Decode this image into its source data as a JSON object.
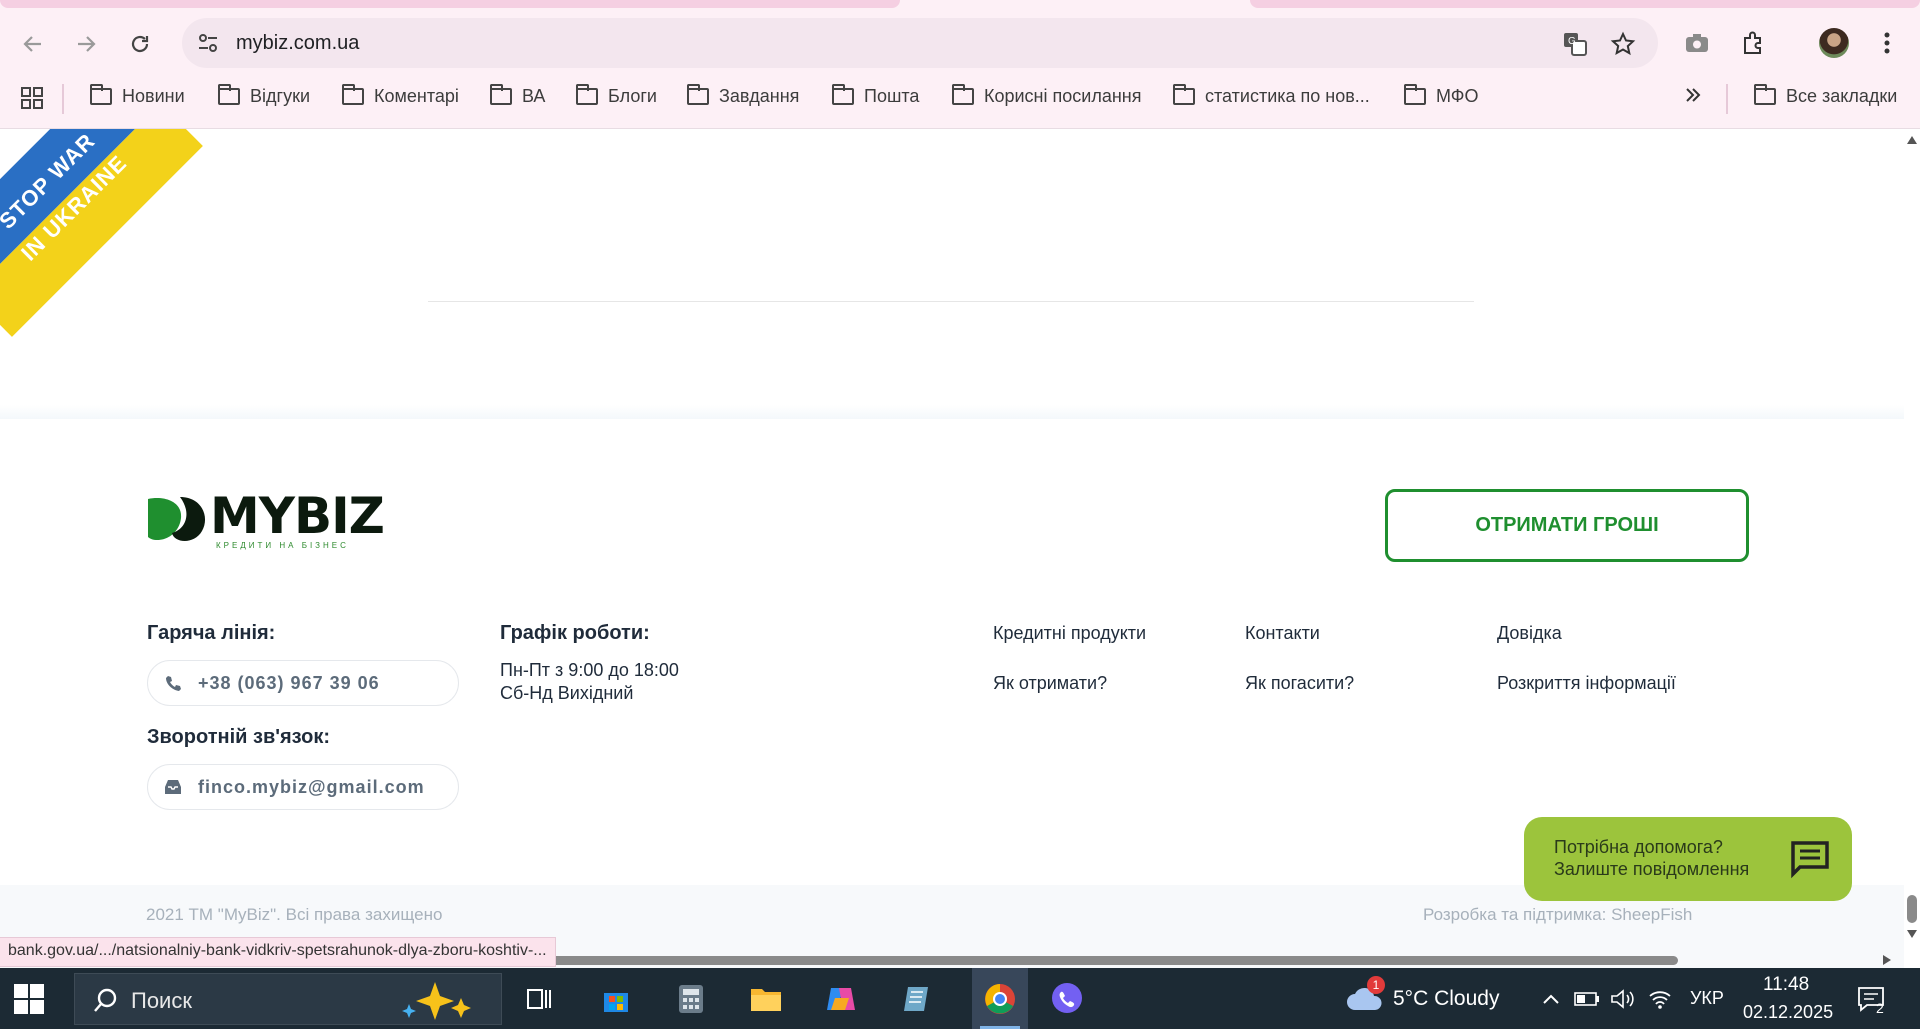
{
  "browser": {
    "url": "mybiz.com.ua",
    "bookmarks": [
      "Новини",
      "Відгуки",
      "Коментарі",
      "ВА",
      "Блоги",
      "Завдання",
      "Пошта",
      "Корисні посилання",
      "статистика по нов...",
      "МФО"
    ],
    "all_bookmarks": "Все закладки",
    "status_url": "bank.gov.ua/.../natsionalniy-bank-vidkriv-spetsrahunok-dlya-zboru-koshtiv-..."
  },
  "ribbon": {
    "line1": "STOP WAR",
    "line2": "IN UKRAINE"
  },
  "footer": {
    "logo_text": "MYBIZ",
    "logo_sub": "КРЕДИТИ НА БІЗНЕС",
    "cta_label": "ОТРИМАТИ ГРОШІ",
    "hotline_label": "Гаряча лінія:",
    "phone": "+38 (063) 967 39 06",
    "feedback_label": "Зворотній зв'язок:",
    "email": "finco.mybiz@gmail.com",
    "schedule_label": "Графік роботи:",
    "schedule_line1": "Пн-Пт з 9:00 до 18:00",
    "schedule_line2": "Сб-Нд Вихідний",
    "links": {
      "credit_products": "Кредитні продукти",
      "contacts": "Контакти",
      "help": "Довідка",
      "how_to_get": "Як отримати?",
      "how_to_repay": "Як погасити?",
      "disclosure": "Розкриття інформації"
    },
    "copyright": "2021 ТМ \"MyBiz\". Всі права захищено",
    "developer": "Розробка та підтримка: SheepFish"
  },
  "help_widget": {
    "line1": "Потрібна допомога?",
    "line2": "Залиште повідомлення"
  },
  "taskbar": {
    "search_placeholder": "Поиск",
    "weather": "5°C  Cloudy",
    "weather_badge": "1",
    "language": "УКР",
    "time": "11:48",
    "date": "02.12.2025",
    "notifications": "2"
  },
  "colors": {
    "brand_green": "#1f8f2f",
    "help_green": "#9cc43c",
    "chrome_bg": "#fdf0f6"
  }
}
